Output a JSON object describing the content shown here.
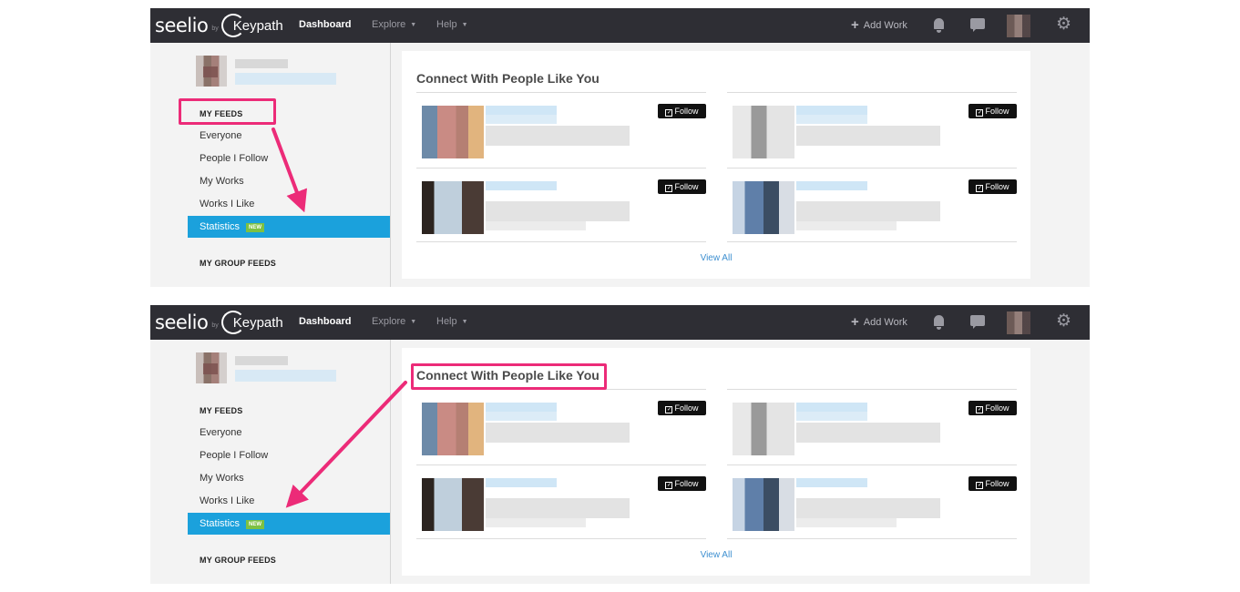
{
  "colors": {
    "topbar": "#2e2e34",
    "accent_blue": "#1ba1dc",
    "new_badge": "#7ec142",
    "highlight": "#ec2b78",
    "link": "#3d8fd0"
  },
  "panels": [
    {
      "topbar": {
        "logo": "seelio",
        "logo_by": "by",
        "logo_partner": "Keypath",
        "nav": [
          "Dashboard",
          "Explore",
          "Help"
        ],
        "add_work": "Add Work"
      },
      "sidebar": {
        "my_feeds": "MY FEEDS",
        "items": [
          "Everyone",
          "People I Follow",
          "My Works",
          "Works I Like",
          "Statistics"
        ],
        "selected": "Statistics",
        "new_badge": "NEW",
        "my_group_feeds": "MY GROUP FEEDS"
      },
      "main": {
        "title": "Connect With People Like You",
        "follow_label": "Follow",
        "view_all": "View All"
      },
      "highlight": "MY FEEDS"
    },
    {
      "topbar": {
        "logo": "seelio",
        "logo_by": "by",
        "logo_partner": "Keypath",
        "nav": [
          "Dashboard",
          "Explore",
          "Help"
        ],
        "add_work": "Add Work"
      },
      "sidebar": {
        "my_feeds": "MY FEEDS",
        "items": [
          "Everyone",
          "People I Follow",
          "My Works",
          "Works I Like",
          "Statistics"
        ],
        "selected": "Statistics",
        "new_badge": "NEW",
        "my_group_feeds": "MY GROUP FEEDS"
      },
      "main": {
        "title": "Connect With People Like You",
        "follow_label": "Follow",
        "view_all": "View All"
      },
      "highlight": "Connect With People Like You"
    }
  ]
}
